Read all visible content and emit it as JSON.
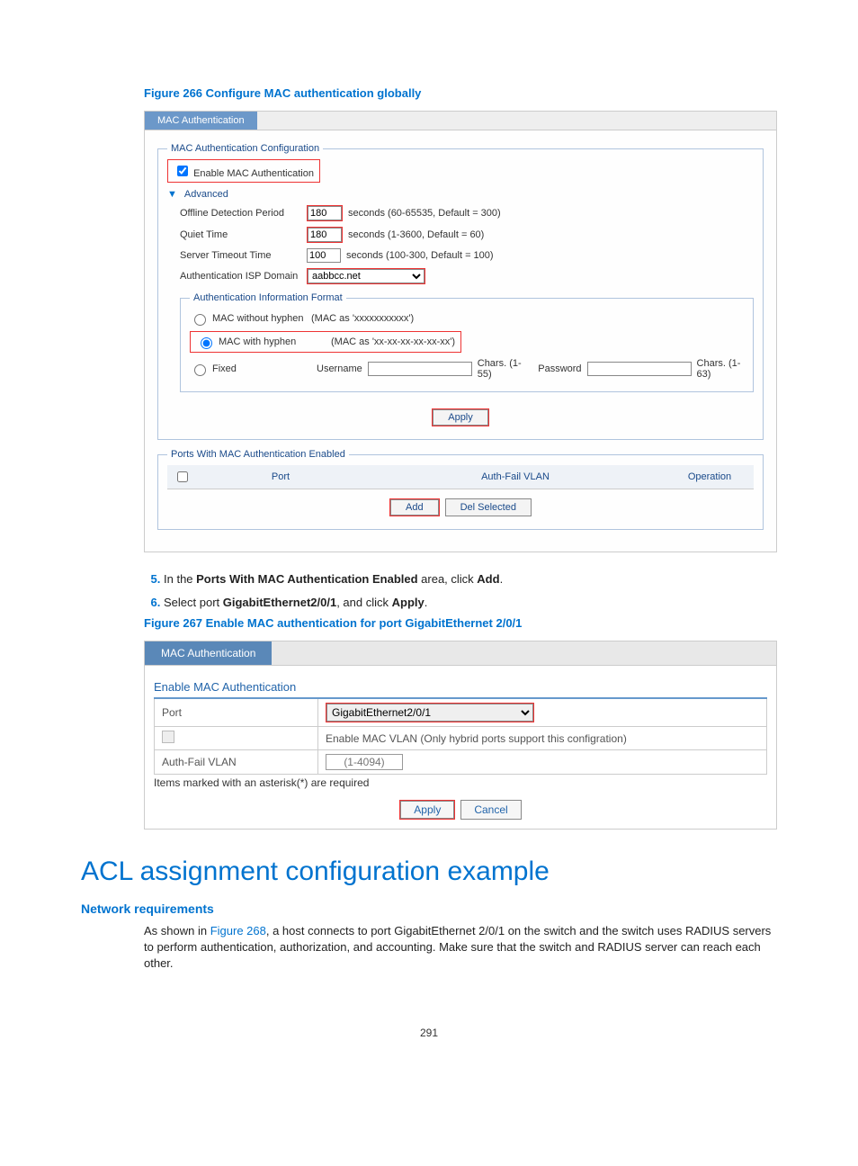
{
  "fig266": {
    "caption": "Figure 266 Configure MAC authentication globally",
    "tab": "MAC Authentication",
    "fieldset1_legend": "MAC Authentication Configuration",
    "enable_label": "Enable MAC Authentication",
    "advanced_label": "Advanced",
    "offline_label": "Offline Detection Period",
    "offline_val": "180",
    "offline_hint": "seconds (60-65535, Default = 300)",
    "quiet_label": "Quiet Time",
    "quiet_val": "180",
    "quiet_hint": "seconds (1-3600, Default = 60)",
    "timeout_label": "Server Timeout Time",
    "timeout_val": "100",
    "timeout_hint": "seconds (100-300, Default = 100)",
    "isp_label": "Authentication ISP Domain",
    "isp_val": "aabbcc.net",
    "fieldset2_legend": "Authentication Information Format",
    "fmt1_label": "MAC without hyphen",
    "fmt1_hint": "(MAC as 'xxxxxxxxxxx')",
    "fmt2_label": "MAC with hyphen",
    "fmt2_hint": "(MAC as 'xx-xx-xx-xx-xx-xx')",
    "fmt3_label": "Fixed",
    "fmt3_user": "Username",
    "fmt3_chars1": "Chars. (1-55)",
    "fmt3_pass": "Password",
    "fmt3_chars2": "Chars. (1-63)",
    "apply_btn": "Apply",
    "fieldset3_legend": "Ports With MAC Authentication Enabled",
    "th_port": "Port",
    "th_vlan": "Auth-Fail VLAN",
    "th_op": "Operation",
    "add_btn": "Add",
    "del_btn": "Del Selected"
  },
  "steps": {
    "s5a": "In the ",
    "s5b": "Ports With MAC Authentication Enabled",
    "s5c": " area, click ",
    "s5d": "Add",
    "s5e": ".",
    "s6a": "Select port ",
    "s6b": "GigabitEthernet2/0/1",
    "s6c": ", and click ",
    "s6d": "Apply",
    "s6e": "."
  },
  "fig267": {
    "caption": "Figure 267 Enable MAC authentication for port GigabitEthernet 2/0/1",
    "tab": "MAC Authentication",
    "section_title": "Enable MAC Authentication",
    "port_label": "Port",
    "port_val": "GigabitEthernet2/0/1",
    "macvlan_label": "Enable MAC VLAN (Only hybrid ports support this configration)",
    "authfail_label": "Auth-Fail VLAN",
    "authfail_ph": "(1-4094)",
    "note": "Items marked with an asterisk(*) are required",
    "apply_btn": "Apply",
    "cancel_btn": "Cancel"
  },
  "sec": {
    "h1": "ACL assignment configuration example",
    "h3": "Network requirements",
    "p_a": "As shown in ",
    "p_link": "Figure 268",
    "p_b": ", a host connects to port GigabitEthernet 2/0/1 on the switch and the switch uses RADIUS servers to perform authentication, authorization, and accounting. Make sure that the switch and RADIUS server can reach each other."
  },
  "pagenum": "291"
}
